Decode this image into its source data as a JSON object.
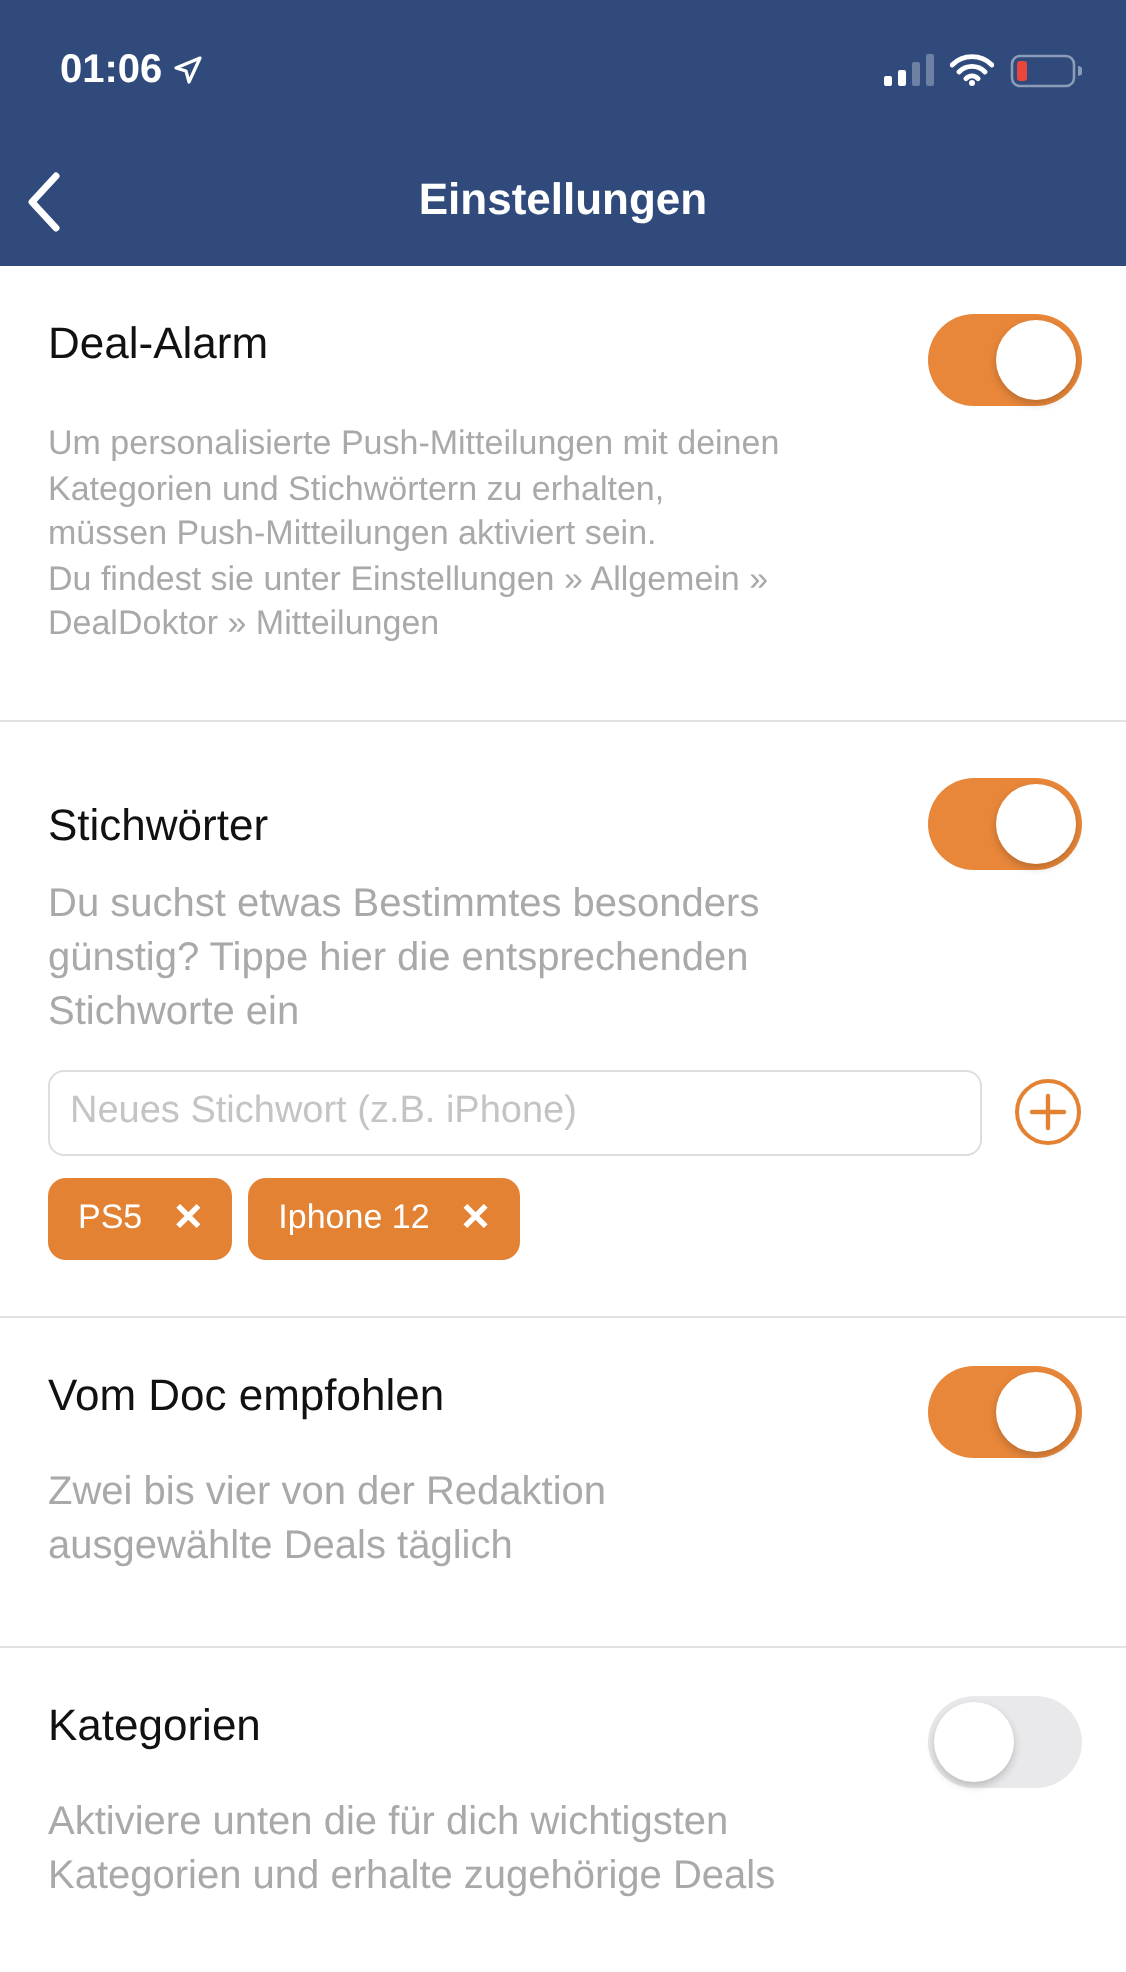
{
  "status_bar": {
    "time": "01:06"
  },
  "nav": {
    "title": "Einstellungen"
  },
  "sections": [
    {
      "kind": "plain",
      "title": "Deal-Alarm",
      "on": true,
      "description": "Um personalisierte Push-Mitteilungen mit deinen\nKategorien und Stichwörtern zu erhalten,\nmüssen Push-Mitteilungen aktiviert sein.\nDu findest sie unter Einstellungen » Allgemein »\nDealDoktor » Mitteilungen"
    },
    {
      "kind": "keywords",
      "title": "Stichwörter",
      "on": true,
      "description": "Du suchst etwas Bestimmtes besonders\ngünstig? Tippe hier die entsprechenden\nStichworte ein",
      "input": {
        "placeholder": "Neues Stichwort (z.B. iPhone)"
      },
      "tags": [
        {
          "label": "PS5",
          "remove": "×"
        },
        {
          "label": "Iphone 12",
          "remove": "×"
        }
      ]
    },
    {
      "kind": "plain",
      "title": "Vom Doc empfohlen",
      "on": true,
      "description": "Zwei bis vier von der Redaktion\nausgewählte Deals täglich"
    },
    {
      "kind": "plain",
      "title": "Kategorien",
      "on": false,
      "description": "Aktiviere unten die für dich wichtigsten\nKategorien und erhalte zugehörige Deals"
    }
  ]
}
